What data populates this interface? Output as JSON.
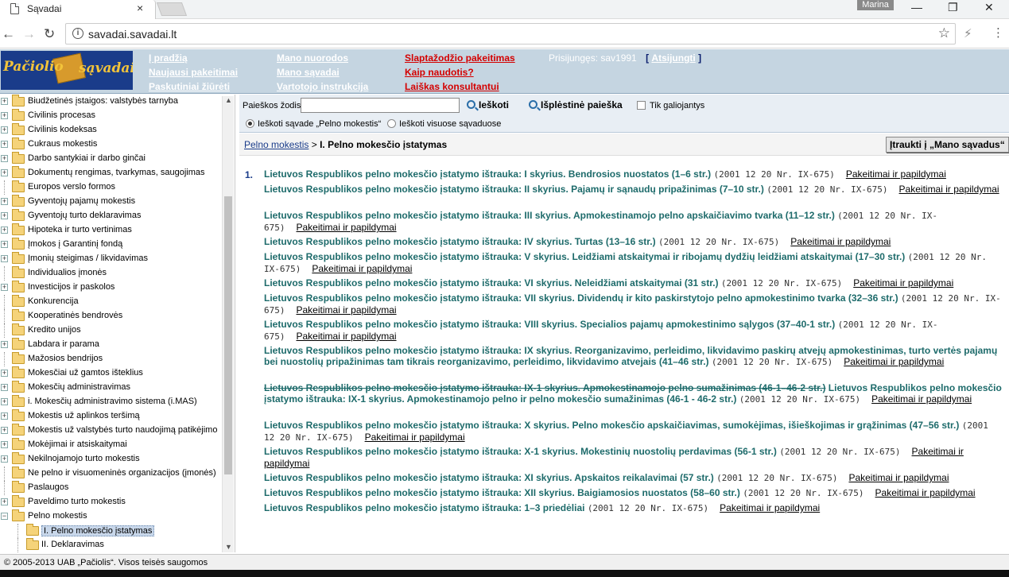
{
  "browser": {
    "tab_title": "Sąvadai",
    "tab_close": "×",
    "user_badge": "Marina",
    "minimize": "—",
    "maximize": "❐",
    "close": "✕",
    "url": "savadai.savadai.lt",
    "back_icon": "←",
    "forward_icon": "→",
    "reload_icon": "↻",
    "star_icon": "☆",
    "ext_icon": "⚡",
    "menu_icon": "⋮"
  },
  "header": {
    "logo_text_1": "Pačiolio",
    "logo_text_2": "sąvadai",
    "col1": [
      "Į pradžią",
      "Naujausi pakeitimai",
      "Paskutiniai žiūrėti"
    ],
    "col2": [
      "Mano nuorodos",
      "Mano sąvadai",
      "Vartotojo instrukcija"
    ],
    "col3": [
      "Slaptažodžio pakeitimas",
      "Kaip naudotis?",
      "Laiškas konsultantui"
    ],
    "login_label": "Prisijungęs: sav1991",
    "login_bracket_open": "[",
    "logout": "Atsijungti",
    "login_bracket_close": "]"
  },
  "tree": {
    "items": [
      {
        "label": "Biudžetinės įstaigos: valstybės tarnyba",
        "exp": "+"
      },
      {
        "label": "Civilinis procesas",
        "exp": "+"
      },
      {
        "label": "Civilinis kodeksas",
        "exp": "+"
      },
      {
        "label": "Cukraus mokestis",
        "exp": "+"
      },
      {
        "label": "Darbo santykiai ir darbo ginčai",
        "exp": "+"
      },
      {
        "label": "Dokumentų rengimas, tvarkymas, saugojimas",
        "exp": "+"
      },
      {
        "label": "Europos verslo formos",
        "exp": ""
      },
      {
        "label": "Gyventojų pajamų mokestis",
        "exp": "+"
      },
      {
        "label": "Gyventojų turto deklaravimas",
        "exp": "+"
      },
      {
        "label": "Hipoteka ir turto vertinimas",
        "exp": "+"
      },
      {
        "label": "Įmokos į Garantinį fondą",
        "exp": "+"
      },
      {
        "label": "Įmonių steigimas / likvidavimas",
        "exp": "+"
      },
      {
        "label": "Individualios įmonės",
        "exp": ""
      },
      {
        "label": "Investicijos ir paskolos",
        "exp": "+"
      },
      {
        "label": "Konkurencija",
        "exp": ""
      },
      {
        "label": "Kooperatinės bendrovės",
        "exp": ""
      },
      {
        "label": "Kredito unijos",
        "exp": ""
      },
      {
        "label": "Labdara ir parama",
        "exp": "+"
      },
      {
        "label": "Mažosios bendrijos",
        "exp": ""
      },
      {
        "label": "Mokesčiai už gamtos išteklius",
        "exp": "+"
      },
      {
        "label": "Mokesčių administravimas",
        "exp": "+"
      },
      {
        "label": "i. Mokesčių administravimo sistema (i.MAS)",
        "exp": "+"
      },
      {
        "label": "Mokestis už aplinkos teršimą",
        "exp": "+"
      },
      {
        "label": "Mokestis už valstybės turto naudojimą patikėjimo",
        "exp": "+"
      },
      {
        "label": "Mokėjimai ir atsiskaitymai",
        "exp": "+"
      },
      {
        "label": "Nekilnojamojo turto mokestis",
        "exp": "+"
      },
      {
        "label": "Ne pelno ir visuomeninės organizacijos (įmonės)",
        "exp": ""
      },
      {
        "label": "Paslaugos",
        "exp": ""
      },
      {
        "label": "Paveldimo turto mokestis",
        "exp": "+"
      },
      {
        "label": "Pelno mokestis",
        "exp": "−"
      }
    ],
    "children": [
      {
        "label": "I. Pelno mokesčio įstatymas",
        "selected": true
      },
      {
        "label": "II. Deklaravimas",
        "selected": false
      }
    ]
  },
  "search": {
    "label": "Paieškos žodis",
    "value": "",
    "button": "Ieškoti",
    "advanced": "Išplėstinė paieška",
    "only_valid": "Tik galiojantys",
    "radio_this": "Ieškoti sąvade „Pelno mokestis“",
    "radio_all": "Ieškoti visuose sąvaduose"
  },
  "breadcrumb": {
    "link": "Pelno mokestis",
    "sep": " > ",
    "current": "I. Pelno mokesčio įstatymas"
  },
  "mano_button": "Įtraukti į „Mano sąvadus“",
  "content": {
    "number": "1.",
    "link_label": "Pakeitimai ir papildymai",
    "entries": [
      {
        "title": "Lietuvos Respublikos pelno mokesčio įstatymo ištrauka: I skyrius. Bendrosios nuostatos (1–6 str.)",
        "date": "(2001 12 20 Nr. IX-675)"
      },
      {
        "title": "Lietuvos Respublikos pelno mokesčio įstatymo ištrauka: II skyrius. Pajamų ir sąnaudų pripažinimas (7–10 str.)",
        "date": "(2001 12 20 Nr. IX-675)"
      },
      {
        "title": "Lietuvos Respublikos pelno mokesčio įstatymo ištrauka: III skyrius. Apmokestinamojo pelno apskaičiavimo tvarka (11–12 str.)",
        "date": "(2001 12 20 Nr. IX-675)"
      },
      {
        "title": "Lietuvos Respublikos pelno mokesčio įstatymo ištrauka: IV skyrius. Turtas (13–16 str.)",
        "date": "(2001 12 20 Nr. IX-675)"
      },
      {
        "title": "Lietuvos Respublikos pelno mokesčio įstatymo ištrauka: V skyrius. Leidžiami atskaitymai ir ribojamų dydžių leidžiami atskaitymai (17–30 str.)",
        "date": "(2001 12 20 Nr. IX-675)"
      },
      {
        "title": "Lietuvos Respublikos pelno mokesčio įstatymo ištrauka: VI skyrius. Neleidžiami atskaitymai (31 str.)",
        "date": "(2001 12 20 Nr. IX-675)"
      },
      {
        "title": "Lietuvos Respublikos pelno mokesčio įstatymo ištrauka: VII skyrius. Dividendų ir kito paskirstytojo pelno apmokestinimo tvarka (32–36 str.)",
        "date": "(2001 12 20 Nr. IX-675)"
      },
      {
        "title": "Lietuvos Respublikos pelno mokesčio įstatymo ištrauka: VIII skyrius. Specialios pajamų apmokestinimo sąlygos (37–40-1 str.)",
        "date": "(2001 12 20 Nr. IX-675)"
      },
      {
        "title": "Lietuvos Respublikos pelno mokesčio įstatymo ištrauka: IX skyrius. Reorganizavimo, perleidimo, likvidavimo paskirų atvejų apmokestinimas, turto vertės pajamų bei nuostolių pripažinimas tam tikrais reorganizavimo, perleidimo, likvidavimo atvejais (41–46 str.)",
        "date": "(2001 12 20 Nr. IX-675)"
      },
      {
        "strike": "Lietuvos Respublikos pelno mokesčio įstatymo ištrauka: IX-1 skyrius. Apmokestinamojo pelno sumažinimas (46-1–46-2 str.)",
        "title": "Lietuvos Respublikos pelno mokesčio įstatymo ištrauka: IX-1 skyrius. Apmokestinamojo pelno ir pelno mokesčio sumažinimas (46-1 - 46-2 str.)",
        "date": "(2001 12 20 Nr. IX-675)"
      },
      {
        "title": "Lietuvos Respublikos pelno mokesčio įstatymo ištrauka: X skyrius. Pelno mokesčio apskaičiavimas, sumokėjimas, išieškojimas ir grąžinimas (47–56 str.)",
        "date": "(2001 12 20 Nr. IX-675)"
      },
      {
        "title": "Lietuvos Respublikos pelno mokesčio įstatymo ištrauka: X-1 skyrius. Mokestinių nuostolių perdavimas (56-1 str.)",
        "date": "(2001 12 20 Nr. IX-675)"
      },
      {
        "title": "Lietuvos Respublikos pelno mokesčio įstatymo ištrauka: XI skyrius. Apskaitos reikalavimai (57 str.)",
        "date": "(2001 12 20 Nr. IX-675)"
      },
      {
        "title": "Lietuvos Respublikos pelno mokesčio įstatymo ištrauka: XII skyrius. Baigiamosios nuostatos (58–60 str.)",
        "date": "(2001 12 20 Nr. IX-675)"
      },
      {
        "title": "Lietuvos Respublikos pelno mokesčio įstatymo ištrauka: 1–3 priedėliai",
        "date": "(2001 12 20 Nr. IX-675)"
      }
    ]
  },
  "footer": "© 2005-2013 UAB „Pačiolis“. Visos teisės saugomos"
}
